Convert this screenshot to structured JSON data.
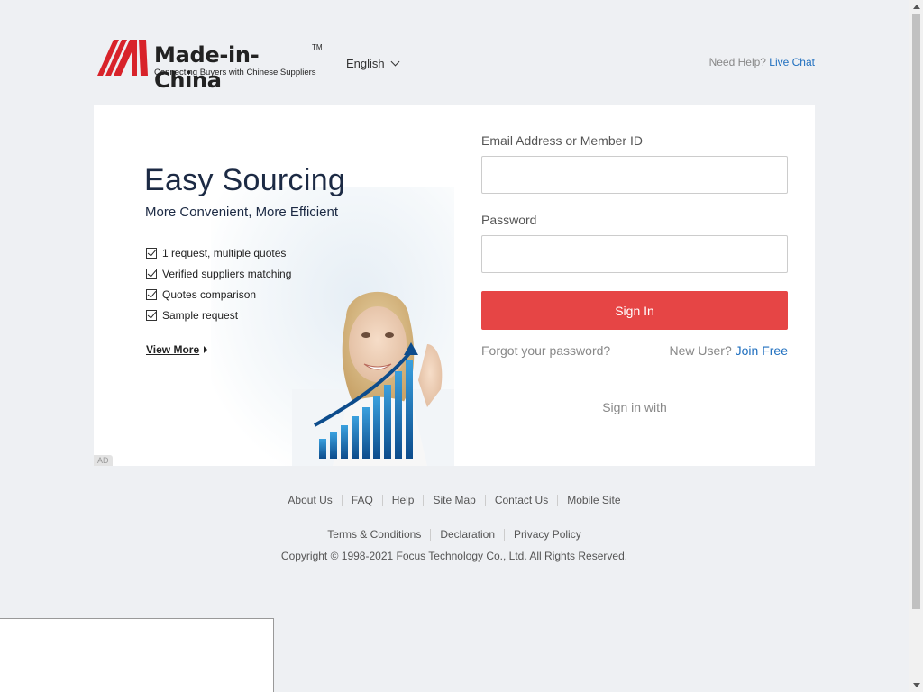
{
  "header": {
    "logo_text": "Made-in-China",
    "logo_tm": "TM",
    "logo_tagline": "Connecting Buyers with Chinese Suppliers",
    "language": "English",
    "help_prefix": "Need Help?",
    "help_link": "Live Chat"
  },
  "promo": {
    "title": "Easy Sourcing",
    "subtitle": "More Convenient, More Efficient",
    "items": [
      "1 request, multiple quotes",
      "Verified suppliers matching",
      "Quotes comparison",
      "Sample request"
    ],
    "view_more": "View More",
    "ad_badge": "AD"
  },
  "form": {
    "email_label": "Email Address or Member ID",
    "email_value": "",
    "password_label": "Password",
    "password_value": "",
    "signin_button": "Sign In",
    "forgot_link": "Forgot your password?",
    "new_user_prefix": "New User?",
    "join_link": "Join Free",
    "sign_in_with": "Sign in with"
  },
  "footer": {
    "links_row1": [
      "About Us",
      "FAQ",
      "Help",
      "Site Map",
      "Contact Us",
      "Mobile Site"
    ],
    "links_row2": [
      "Terms & Conditions",
      "Declaration",
      "Privacy Policy"
    ],
    "copyright": "Copyright © 1998-2021 Focus Technology Co., Ltd. All Rights Reserved."
  },
  "colors": {
    "brand_red": "#d8232a",
    "signin_button": "#e64545",
    "link_blue": "#1f6fbf",
    "page_background": "#eef0f3"
  }
}
